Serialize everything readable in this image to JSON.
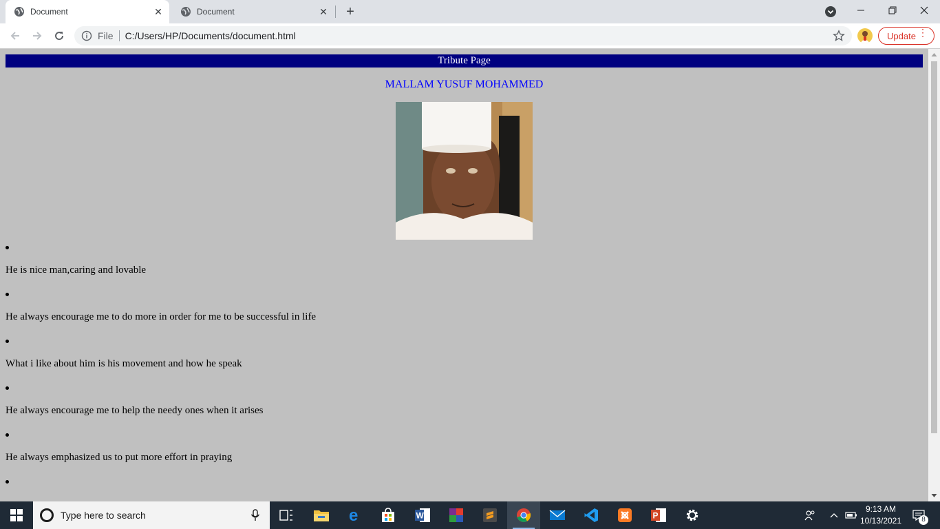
{
  "browser": {
    "tabs": [
      {
        "title": "Document",
        "active": true
      },
      {
        "title": "Document",
        "active": false
      }
    ],
    "new_tab_symbol": "+",
    "address": {
      "scheme_label": "File",
      "url": "C:/Users/HP/Documents/document.html"
    },
    "update_label": "Update"
  },
  "page": {
    "banner": "Tribute Page",
    "name": "MALLAM YUSUF MOHAMMED",
    "bullets": [
      "He is nice man,caring and lovable",
      "He always encourage me to do more in order for me to be successful in life",
      "What i like about him is his movement and how he speak",
      "He always encourage me to help the needy ones when it arises",
      "He always emphasized us to put more effort in praying",
      ""
    ]
  },
  "taskbar": {
    "search_placeholder": "Type here to search",
    "time": "9:13 AM",
    "date": "10/13/2021",
    "notification_count": "8",
    "apps": [
      "task-view-icon",
      "file-explorer-icon",
      "edge-icon",
      "store-icon",
      "word-icon",
      "winrar-icon",
      "sublime-icon",
      "chrome-icon",
      "mail-icon",
      "vscode-icon",
      "xampp-icon",
      "powerpoint-icon",
      "settings-icon"
    ]
  },
  "colors": {
    "page_background": "#c0c0c0",
    "banner_background": "#000080",
    "name_color": "#0000ff",
    "update_accent": "#d93025"
  }
}
